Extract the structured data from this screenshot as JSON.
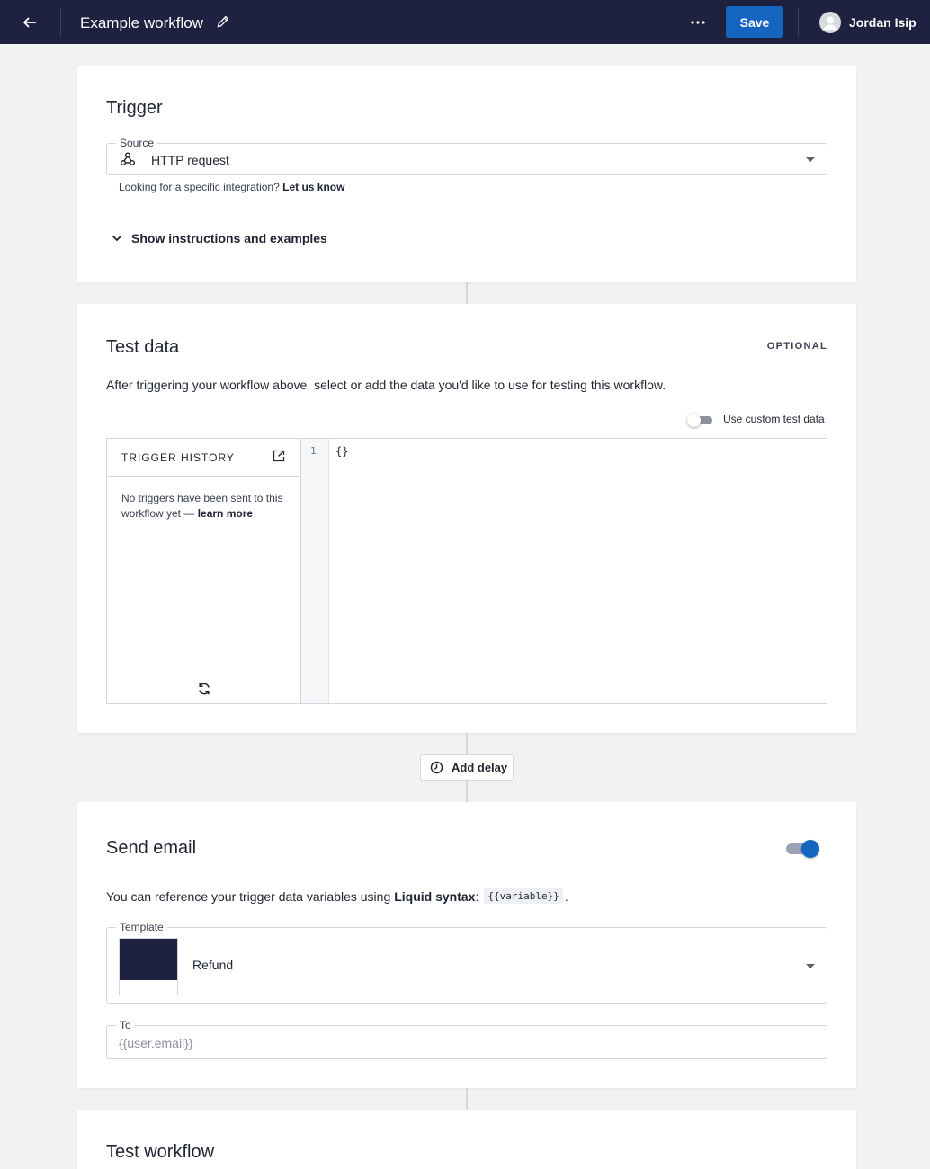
{
  "topbar": {
    "title": "Example workflow",
    "save_label": "Save",
    "user_name": "Jordan Isip"
  },
  "trigger": {
    "title": "Trigger",
    "source_label": "Source",
    "source_value": "HTTP request",
    "note_prefix": "Looking for a specific integration?",
    "note_link": "Let us know",
    "show_instructions": "Show instructions and examples"
  },
  "test_data": {
    "title": "Test data",
    "optional_label": "OPTIONAL",
    "description": "After triggering your workflow above, select or add the data you'd like to use for testing this workflow.",
    "custom_toggle_label": "Use custom test data",
    "custom_toggle_on": false,
    "trigger_history_title": "TRIGGER HISTORY",
    "empty_text": "No triggers have been sent to this workflow yet —",
    "learn_more": "learn more",
    "line_number": "1",
    "code": "{}"
  },
  "add_delay_label": "Add delay",
  "send_email": {
    "title": "Send email",
    "enabled": true,
    "liquid_prefix": "You can reference your trigger data variables using",
    "liquid_bold": "Liquid syntax",
    "liquid_colon": ":",
    "liquid_code": "{{variable}}",
    "liquid_period": ".",
    "template_label": "Template",
    "template_value": "Refund",
    "to_label": "To",
    "to_value": "{{user.email}}"
  },
  "test_workflow": {
    "title": "Test workflow"
  },
  "colors": {
    "topbar_bg": "#1e2240",
    "primary": "#1565c0",
    "page_bg": "#f1f2f4"
  },
  "icons": [
    "arrow-left-icon",
    "pencil-icon",
    "more-horizontal-icon",
    "user-icon",
    "webhook-icon",
    "chevron-down-icon",
    "caret-down-icon",
    "open-in-new-icon",
    "refresh-icon",
    "timer-icon"
  ]
}
